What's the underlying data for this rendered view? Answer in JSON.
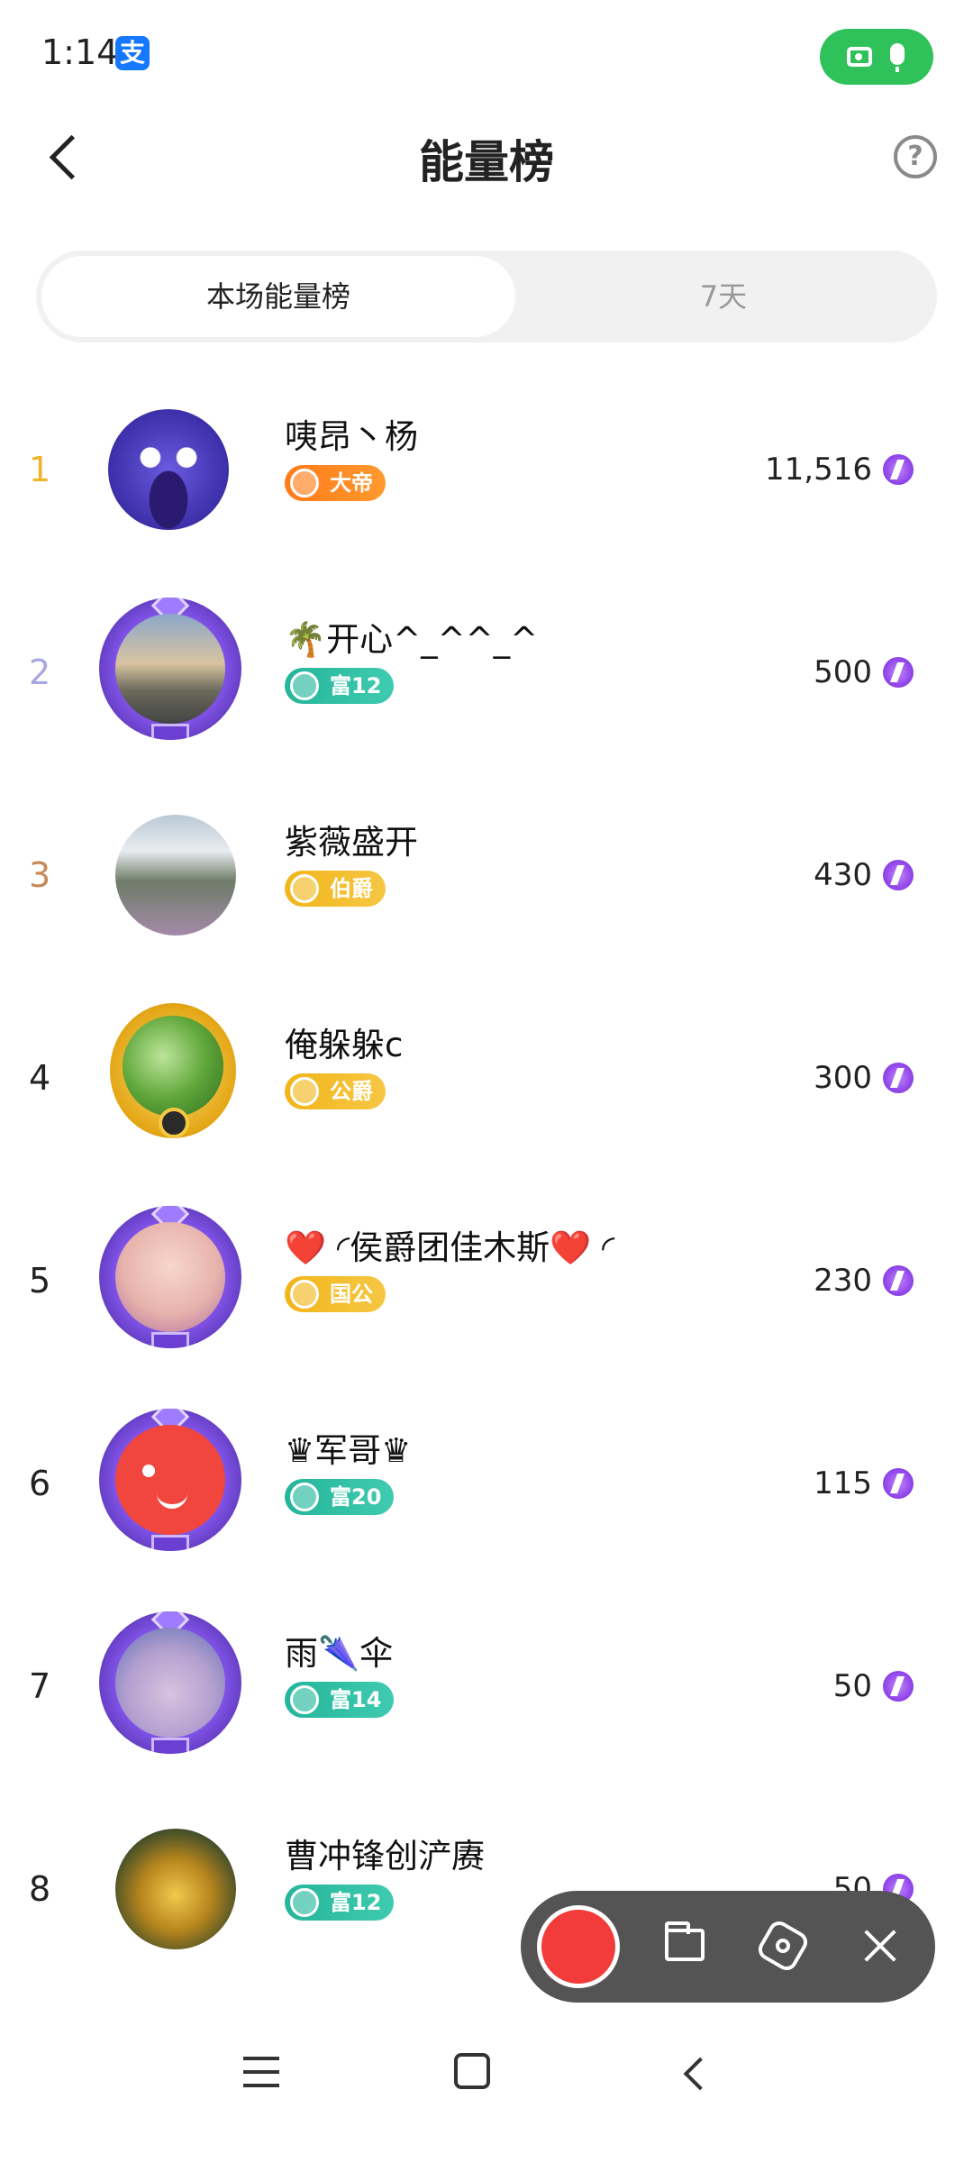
{
  "status_bar": {
    "time": "1:14",
    "app_icon": "alipay-icon"
  },
  "header": {
    "title": "能量榜",
    "back_icon": "chevron-left-icon",
    "help_icon": "question-icon",
    "help_label": "?"
  },
  "tabs": [
    {
      "label": "本场能量榜",
      "active": true
    },
    {
      "label": "7天",
      "active": false
    }
  ],
  "ranking": [
    {
      "rank": "1",
      "name": "咦昂丶杨",
      "badge": "大帝",
      "badge_color": "#ff7a1a",
      "score": "11,516"
    },
    {
      "rank": "2",
      "name": "🌴开心^_^^_^",
      "badge": "富12",
      "badge_color": "#25b59a",
      "score": "500"
    },
    {
      "rank": "3",
      "name": "紫薇盛开",
      "badge": "伯爵",
      "badge_color": "#f2b51a",
      "score": "430"
    },
    {
      "rank": "4",
      "name": "俺躲躲c",
      "badge": "公爵",
      "badge_color": "#f2b51a",
      "score": "300"
    },
    {
      "rank": "5",
      "name": "❤️ ◜侯爵团佳木斯❤️ ◜",
      "badge": "国公",
      "badge_color": "#f2b51a",
      "score": "230"
    },
    {
      "rank": "6",
      "name": "♛军哥♛",
      "badge": "富20",
      "badge_color": "#25b59a",
      "score": "115"
    },
    {
      "rank": "7",
      "name": "雨🌂伞",
      "badge": "富14",
      "badge_color": "#25b59a",
      "score": "50"
    },
    {
      "rank": "8",
      "name": "曹冲锋创浐赓",
      "badge": "富12",
      "badge_color": "#25b59a",
      "score": "50"
    }
  ],
  "score_icon": "energy-lightning-icon",
  "recorder_toolbar": {
    "record_icon": "record-icon",
    "folder_icon": "folder-icon",
    "settings_icon": "settings-icon",
    "close_icon": "close-icon"
  },
  "nav_bar": {
    "menu_icon": "menu-icon",
    "home_icon": "home-icon",
    "back_icon": "back-icon"
  },
  "colors": {
    "accent_green": "#2fc25b",
    "rank_gold": "#f0b429",
    "rank_silver": "#a9a6e2",
    "rank_bronze": "#c98957",
    "energy_purple": "#8b3fe6"
  }
}
